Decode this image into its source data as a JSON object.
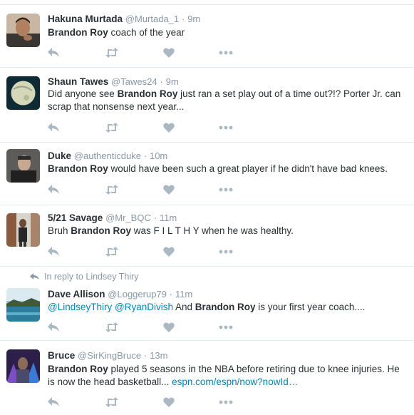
{
  "tweets": [
    {
      "name": "Hakuna Murtada",
      "handle": "@Murtada_1",
      "sep": "·",
      "time": "9m",
      "segments": [
        {
          "t": "Brandon Roy",
          "b": true
        },
        {
          "t": " coach of the year"
        }
      ]
    },
    {
      "name": "Shaun Tawes",
      "handle": "@Tawes24",
      "sep": "·",
      "time": "9m",
      "segments": [
        {
          "t": "Did anyone see "
        },
        {
          "t": "Brandon Roy",
          "b": true
        },
        {
          "t": " just ran a set play out of a time out?!? Porter Jr. can scrap that nonsense next year..."
        }
      ]
    },
    {
      "name": "Duke",
      "handle": "@authenticduke",
      "sep": "·",
      "time": "10m",
      "segments": [
        {
          "t": "Brandon Roy",
          "b": true
        },
        {
          "t": " would have been such a great player if he didn't have bad knees."
        }
      ]
    },
    {
      "name": "5/21 Savage",
      "handle": "@Mr_BQC",
      "sep": "·",
      "time": "11m",
      "segments": [
        {
          "t": "Bruh "
        },
        {
          "t": "Brandon Roy",
          "b": true
        },
        {
          "t": " was F I L T H Y when he was healthy."
        }
      ]
    },
    {
      "reply_context": "In reply to Lindsey Thiry",
      "name": "Dave Allison",
      "handle": "@Loggerup79",
      "sep": "·",
      "time": "11m",
      "segments": [
        {
          "t": "@LindseyThiry",
          "link": true
        },
        {
          "t": " "
        },
        {
          "t": "@RyanDivish",
          "link": true
        },
        {
          "t": " And "
        },
        {
          "t": "Brandon Roy",
          "b": true
        },
        {
          "t": " is your first year coach...."
        }
      ]
    },
    {
      "name": "Bruce",
      "handle": "@SirKingBruce",
      "sep": "·",
      "time": "13m",
      "segments": [
        {
          "t": "Brandon Roy",
          "b": true
        },
        {
          "t": " played 5  seasons in the NBA before retiring due to knee injuries. He is now the head basketball... "
        },
        {
          "t": "espn.com/espn/now?nowId…",
          "link": true
        }
      ]
    }
  ],
  "icons": {
    "reply": "reply-arrow-icon",
    "retweet": "retweet-icon",
    "like": "heart-icon",
    "more": "more-dots-icon"
  },
  "colors": {
    "action_gray": "#aab8c2",
    "link": "#0084b4",
    "meta": "#8899a6",
    "divider": "#e1e8ed"
  }
}
